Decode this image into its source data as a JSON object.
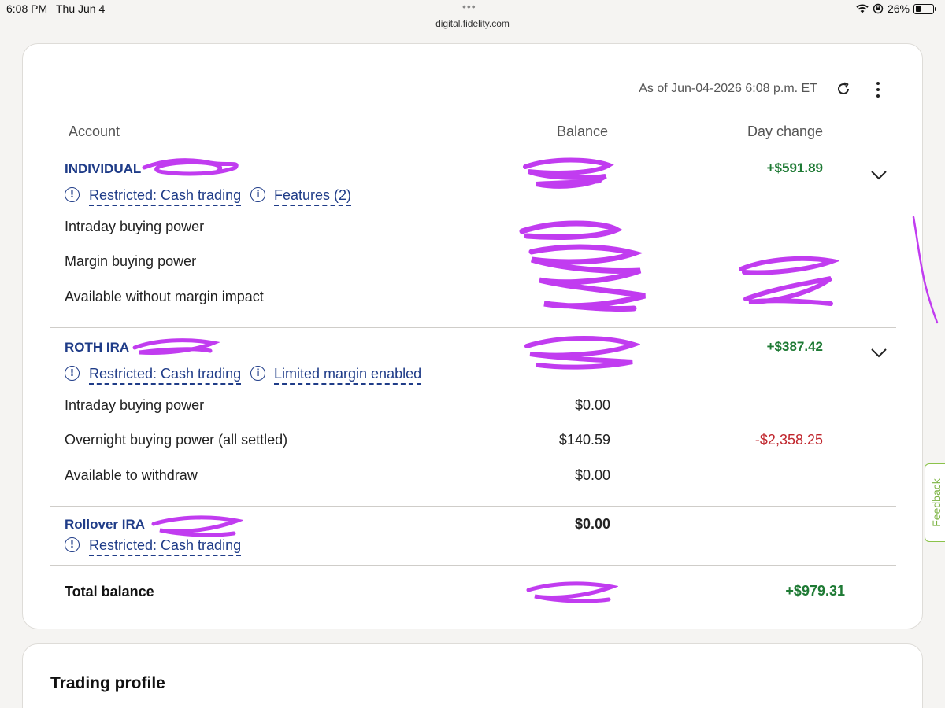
{
  "status_bar": {
    "time": "6:08 PM",
    "date": "Thu Jun 4",
    "battery_percent": "26%",
    "battery_level": 0.26,
    "url": "digital.fidelity.com",
    "icons": [
      "wifi-icon",
      "orientation-lock-icon",
      "battery-icon"
    ]
  },
  "header": {
    "as_of": "As of Jun-04-2026 6:08 p.m. ET",
    "refresh_icon": "refresh-icon",
    "menu_icon": "more-vertical-icon"
  },
  "table": {
    "columns": [
      "Account",
      "Balance",
      "Day change"
    ]
  },
  "accounts": [
    {
      "name": "INDIVIDUAL",
      "balance": "",
      "day_change": "+$591.89",
      "tags": [
        "Restricted: Cash trading",
        "Features (2)"
      ],
      "rows": [
        {
          "label": "Intraday buying power",
          "value": "",
          "change": ""
        },
        {
          "label": "Margin buying power",
          "value": "",
          "change": ""
        },
        {
          "label": "Available without margin impact",
          "value": "",
          "change": ""
        }
      ]
    },
    {
      "name": "ROTH IRA",
      "balance": "",
      "day_change": "+$387.42",
      "tags": [
        "Restricted: Cash trading",
        "Limited margin enabled"
      ],
      "rows": [
        {
          "label": "Intraday buying power",
          "value": "$0.00",
          "change": ""
        },
        {
          "label": "Overnight buying power (all settled)",
          "value": "$140.59",
          "change": "-$2,358.25"
        },
        {
          "label": "Available to withdraw",
          "value": "$0.00",
          "change": ""
        }
      ]
    },
    {
      "name": "Rollover IRA",
      "balance": "$0.00",
      "day_change": "",
      "tags": [
        "Restricted: Cash trading"
      ]
    }
  ],
  "total": {
    "label": "Total balance",
    "balance": "",
    "day_change": "+$979.31"
  },
  "trading_profile": {
    "title": "Trading profile"
  },
  "feedback": {
    "label": "Feedback"
  },
  "colors": {
    "link_blue": "#1f3c88",
    "positive_green": "#1e7a34",
    "negative_red": "#c0262d",
    "redaction_purple": "#c13cf0",
    "feedback_green": "#7cb342"
  }
}
